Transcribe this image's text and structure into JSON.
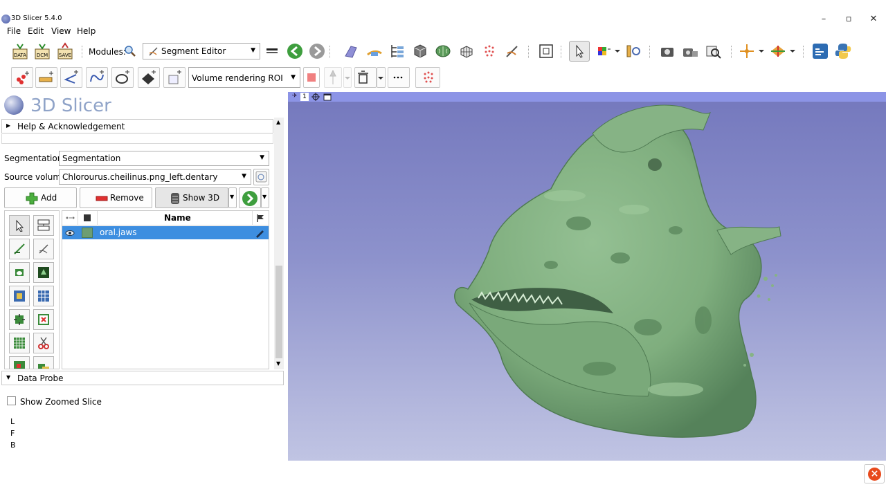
{
  "window": {
    "title": "3D Slicer 5.4.0",
    "minimize": "–",
    "maximize": "▫",
    "close": "✕"
  },
  "menu": {
    "file": "File",
    "edit": "Edit",
    "view": "View",
    "help": "Help"
  },
  "toolbar": {
    "data_label": "DATA",
    "dcm_label": "DCM",
    "save_label": "SAVE",
    "modules_label": "Modules:",
    "module_selected": "Segment Editor"
  },
  "markups_toolbar": {
    "roi_selected": "Volume rendering ROI"
  },
  "panel": {
    "logo_text": "3D Slicer",
    "help_section": "Help & Acknowledgement",
    "segmentation_label": "Segmentation:",
    "segmentation_value": "Segmentation",
    "source_volume_label": "Source volume:",
    "source_volume_value": "Chlorourus.cheilinus.png_left.dentary",
    "add_label": "Add",
    "remove_label": "Remove",
    "show3d_label": "Show 3D",
    "table_header_name": "Name",
    "segments": [
      {
        "name": "oral.jaws",
        "color": "#6d9e73"
      }
    ],
    "data_probe_section": "Data Probe",
    "show_zoomed_slice": "Show Zoomed Slice",
    "probe_lines": [
      "L",
      "F",
      "B"
    ]
  },
  "viewer": {
    "view_number": "1",
    "model_color": "#7fae7e"
  },
  "colors": {
    "accent": "#3d8ee0",
    "viewer_bg_top": "#7478bd",
    "viewer_bg_bottom": "#c0c4e3"
  }
}
